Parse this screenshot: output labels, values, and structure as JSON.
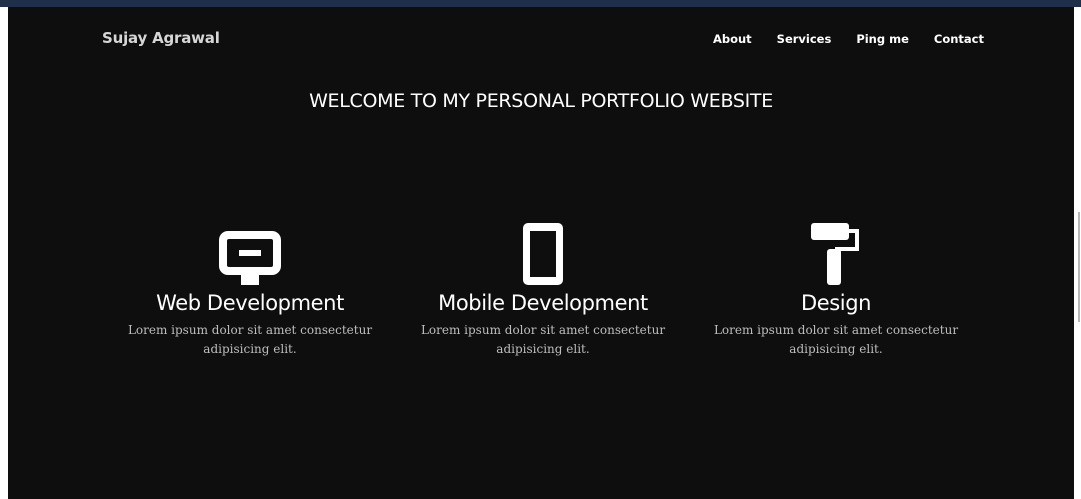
{
  "header": {
    "brand": "Sujay Agrawal",
    "nav": [
      "About",
      "Services",
      "Ping me",
      "Contact"
    ]
  },
  "hero": {
    "title": "WELCOME TO MY PERSONAL PORTFOLIO WEBSITE"
  },
  "services": [
    {
      "icon": "desktop-icon",
      "title": "Web Development",
      "description": "Lorem ipsum dolor sit amet consectetur adipisicing elit."
    },
    {
      "icon": "mobile-icon",
      "title": "Mobile Development",
      "description": "Lorem ipsum dolor sit amet consectetur adipisicing elit."
    },
    {
      "icon": "paint-roller-icon",
      "title": "Design",
      "description": "Lorem ipsum dolor sit amet consectetur adipisicing elit."
    }
  ],
  "colors": {
    "background": "#0e0e0e",
    "text": "#ffffff",
    "muted_text": "#bdbdbd"
  }
}
